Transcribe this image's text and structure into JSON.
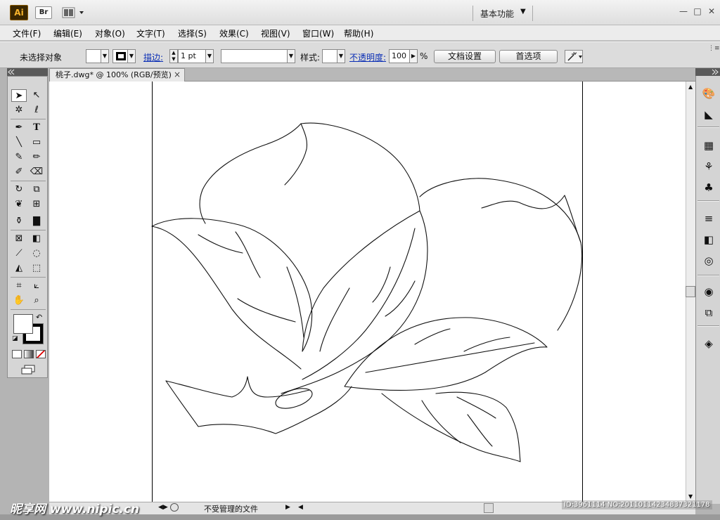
{
  "app": {
    "logo_text": "Ai",
    "bridge_label": "Br",
    "workspace": "基本功能",
    "colors": {
      "logo_bg": "#3a2700",
      "logo_fg": "#f7b42c",
      "link": "#0b2fb5"
    }
  },
  "menu": {
    "items": [
      "文件(F)",
      "编辑(E)",
      "对象(O)",
      "文字(T)",
      "选择(S)",
      "效果(C)",
      "视图(V)",
      "窗口(W)",
      "帮助(H)"
    ]
  },
  "control": {
    "selection": "未选择对象",
    "stroke_label": "描边:",
    "stroke_weight": "1 pt",
    "style_label": "样式:",
    "opacity_label": "不透明度:",
    "opacity_value": "100",
    "opacity_unit": "%",
    "doc_setup": "文档设置",
    "preferences": "首选项"
  },
  "document": {
    "tab_title": "桃子.dwg* @ 100% (RGB/预览)",
    "close_glyph": "×"
  },
  "status": {
    "text": "不受管理的文件"
  },
  "watermark": {
    "left": "昵享网 www.nipic.cn",
    "right": "ID:3961114 NO:20110114234837321178"
  },
  "icons": {
    "tools": [
      "selection-icon",
      "direct-selection-icon",
      "magic-wand-icon",
      "lasso-icon",
      "pen-icon",
      "type-icon",
      "line-icon",
      "rectangle-icon",
      "paintbrush-icon",
      "pencil-icon",
      "blob-brush-icon",
      "eraser-icon",
      "rotate-icon",
      "scale-icon",
      "warp-icon",
      "free-transform-icon",
      "symbol-sprayer-icon",
      "column-graph-icon",
      "mesh-icon",
      "gradient-icon",
      "eyedropper-icon",
      "blend-icon",
      "live-paint-icon",
      "live-paint-select-icon",
      "crop-icon",
      "slice-icon",
      "hand-icon",
      "zoom-icon"
    ],
    "dock": [
      "color-guide-icon",
      "color-icon",
      "swatches-icon",
      "brushes-icon",
      "symbols-icon",
      "stroke-icon",
      "gradient-panel-icon",
      "transparency-icon",
      "appearance-icon",
      "graphic-styles-icon",
      "layers-icon"
    ]
  }
}
